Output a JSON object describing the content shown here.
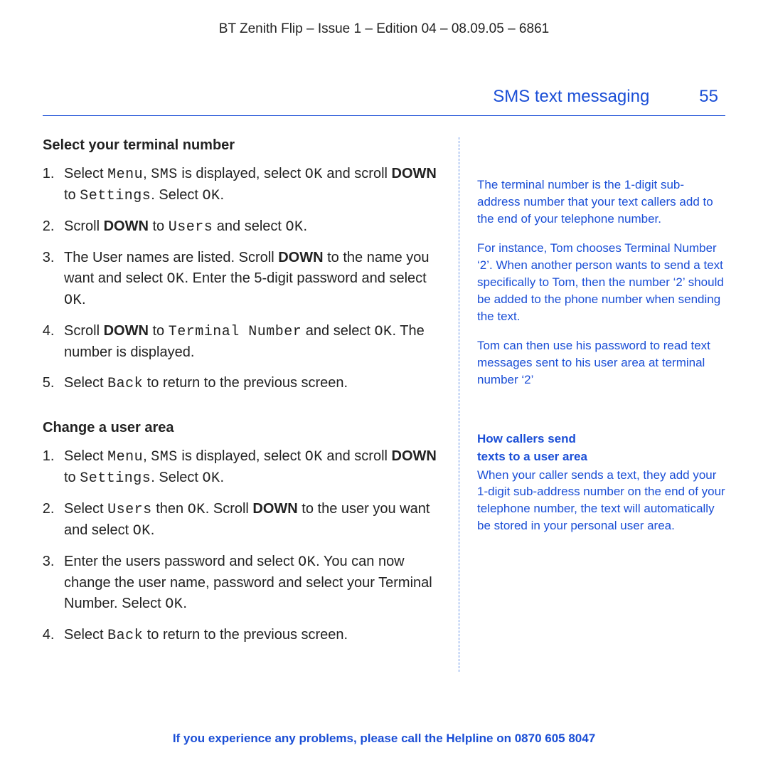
{
  "docline": "BT Zenith Flip – Issue 1 – Edition 04 – 08.09.05 – 6861",
  "section": "SMS text messaging",
  "pagenum": "55",
  "main": {
    "h1": "Select your terminal number",
    "steps1": {
      "s1a": "Select ",
      "s1_menu": "Menu",
      "s1b": ", ",
      "s1_sms": "SMS",
      "s1c": " is displayed, select ",
      "s1_ok": "OK",
      "s1d": " and scroll ",
      "s1_down": "DOWN",
      "s1e": " to ",
      "s1_settings": "Settings",
      "s1f": ". Select ",
      "s1_ok2": "OK",
      "s1g": ".",
      "s2a": "Scroll ",
      "s2_down": "DOWN",
      "s2b": " to ",
      "s2_users": "Users",
      "s2c": " and select ",
      "s2_ok": "OK",
      "s2d": ".",
      "s3a": "The User names are listed. Scroll ",
      "s3_down": "DOWN",
      "s3b": " to the name you want and select ",
      "s3_ok": "OK",
      "s3c": ". Enter the 5-digit password and select ",
      "s3_ok2": "OK",
      "s3d": ".",
      "s4a": "Scroll ",
      "s4_down": "DOWN",
      "s4b": " to ",
      "s4_tn": "Terminal Number",
      "s4c": " and select ",
      "s4_ok": "OK",
      "s4d": ". The number is displayed.",
      "s5a": "Select ",
      "s5_back": "Back",
      "s5b": " to return to the previous screen."
    },
    "h2": "Change a user area",
    "steps2": {
      "s1a": "Select ",
      "s1_menu": "Menu",
      "s1b": ", ",
      "s1_sms": "SMS",
      "s1c": " is displayed, select ",
      "s1_ok": "OK",
      "s1d": " and scroll ",
      "s1_down": "DOWN",
      "s1e": " to ",
      "s1_settings": "Settings",
      "s1f": ". Select ",
      "s1_ok2": "OK",
      "s1g": ".",
      "s2a": "Select ",
      "s2_users": "Users",
      "s2b": " then ",
      "s2_ok": "OK",
      "s2c": ". Scroll ",
      "s2_down": "DOWN",
      "s2d": " to the user you want and select ",
      "s2_ok2": "OK",
      "s2e": ".",
      "s3a": "Enter the users password and select ",
      "s3_ok": "OK",
      "s3b": ". You can now change the user name, password and select your Terminal Number. Select ",
      "s3_ok2": "OK",
      "s3c": ".",
      "s4a": "Select ",
      "s4_back": "Back",
      "s4b": " to return to the previous screen."
    }
  },
  "side": {
    "p1": "The terminal number is the 1-digit sub-address number that your text callers add to the end of your telephone number.",
    "p2": "For instance, Tom chooses Terminal Number ‘2’. When another person wants to send a text specifically to Tom, then the number ‘2’ should be added to the phone number when sending the text.",
    "p3": "Tom can then use his password to read text messages sent to his user area at terminal number ‘2’",
    "h2a": "How callers send",
    "h2b": "texts to a user area",
    "p4": "When your caller sends a text, they add your 1-digit sub-address number on the end of your telephone number, the text will automatically be stored in your personal user area."
  },
  "footer": {
    "a": "If you experience any problems, please call the Helpline on ",
    "b": "0870 605 8047"
  }
}
